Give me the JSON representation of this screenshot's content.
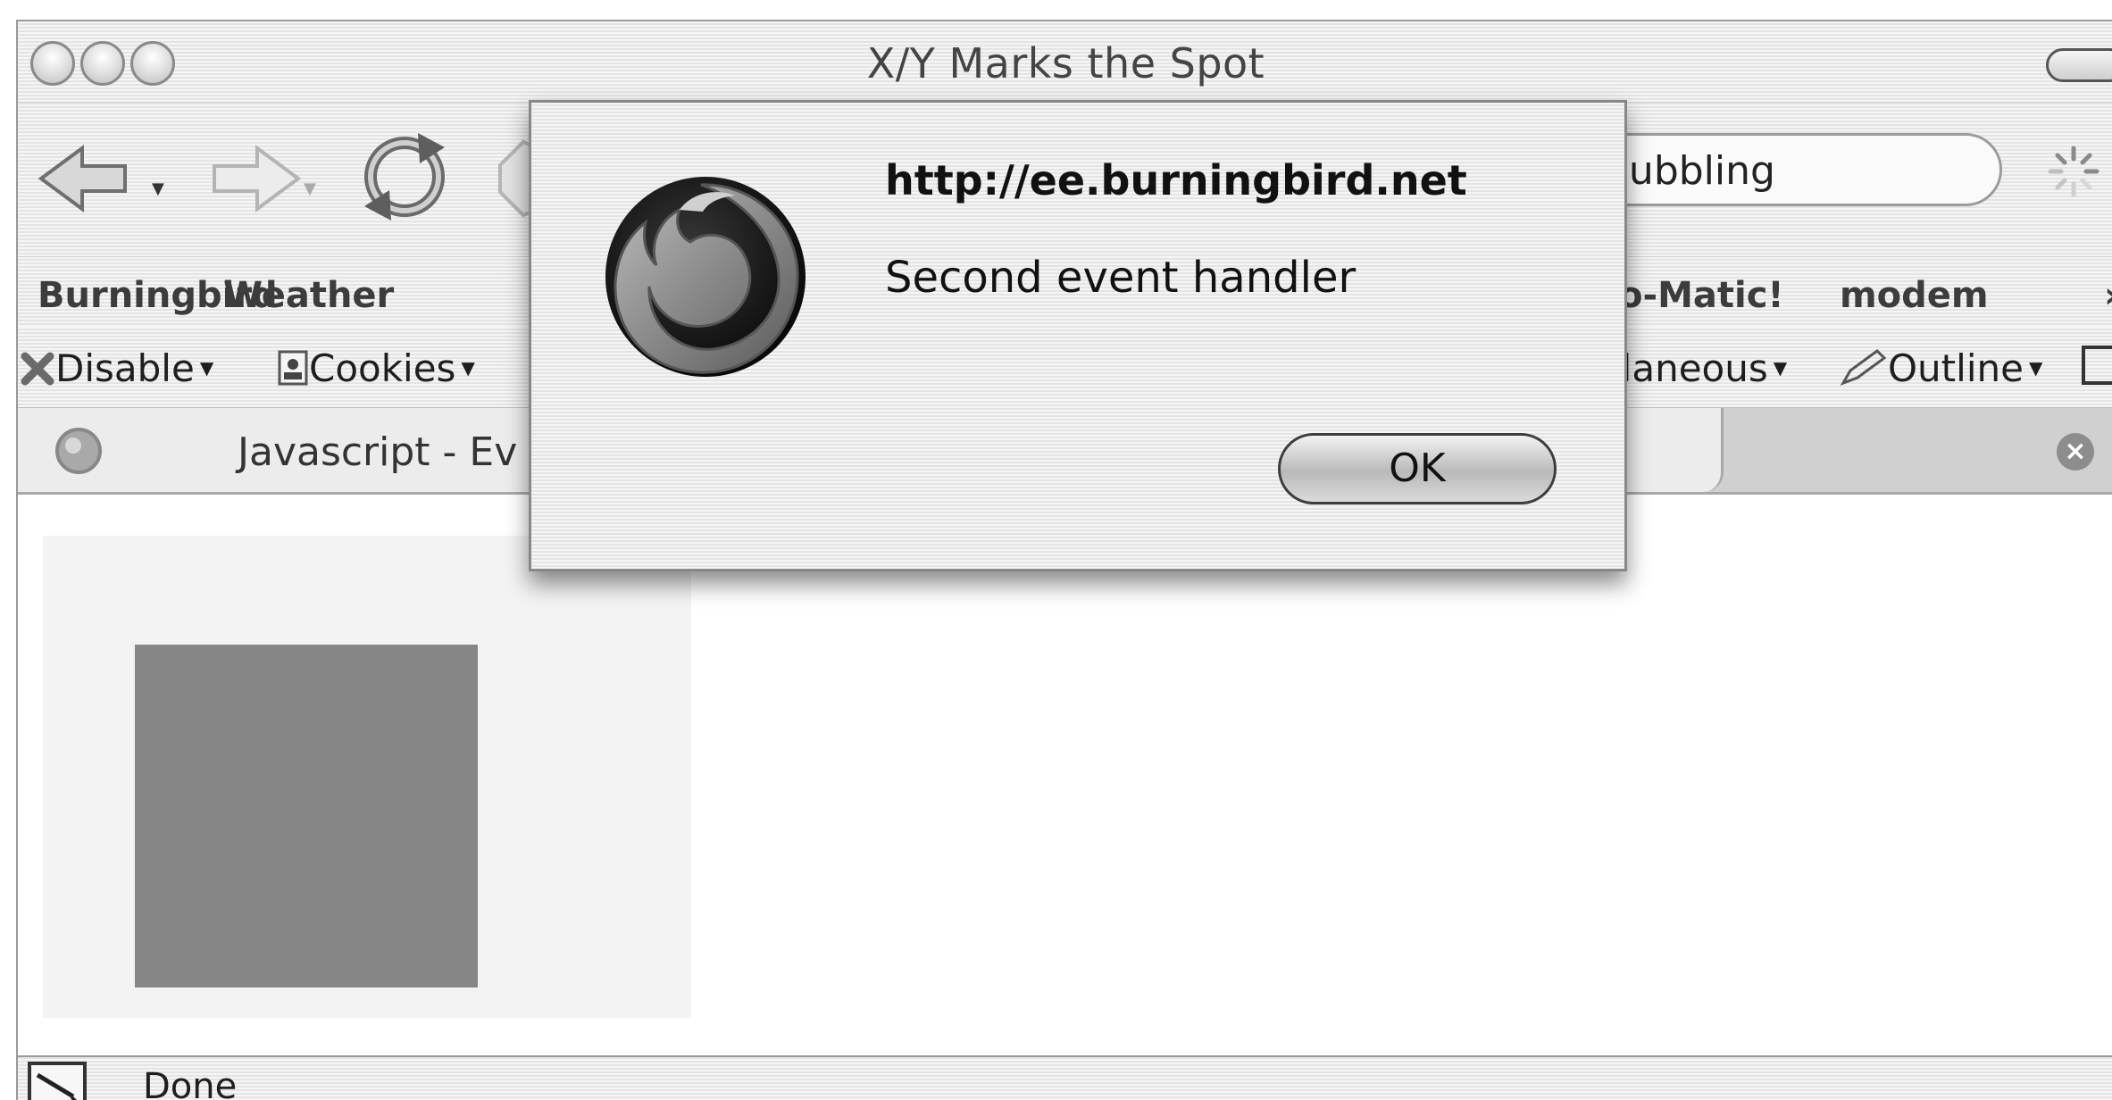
{
  "window": {
    "title": "X/Y Marks the Spot"
  },
  "search": {
    "value": "bubbling"
  },
  "bookmarks": [
    {
      "label": "Burningbird"
    },
    {
      "label": "Weather"
    },
    {
      "label": "o-Matic!"
    },
    {
      "label": "modem"
    }
  ],
  "devtoolbar": [
    {
      "label": "Disable",
      "icon": "x-icon"
    },
    {
      "label": "Cookies",
      "icon": "cookie-icon"
    },
    {
      "label": "llaneous"
    },
    {
      "label": "Outline",
      "icon": "pencil-icon"
    }
  ],
  "tab": {
    "title": "Javascript - Ev"
  },
  "status": {
    "text": "Done"
  },
  "dialog": {
    "url": "http://ee.burningbird.net",
    "message": "Second event handler",
    "ok_label": "OK",
    "icon": "firefox-logo-icon"
  },
  "content": {
    "outer_color": "#f3f3f3",
    "inner_color": "#868686"
  }
}
